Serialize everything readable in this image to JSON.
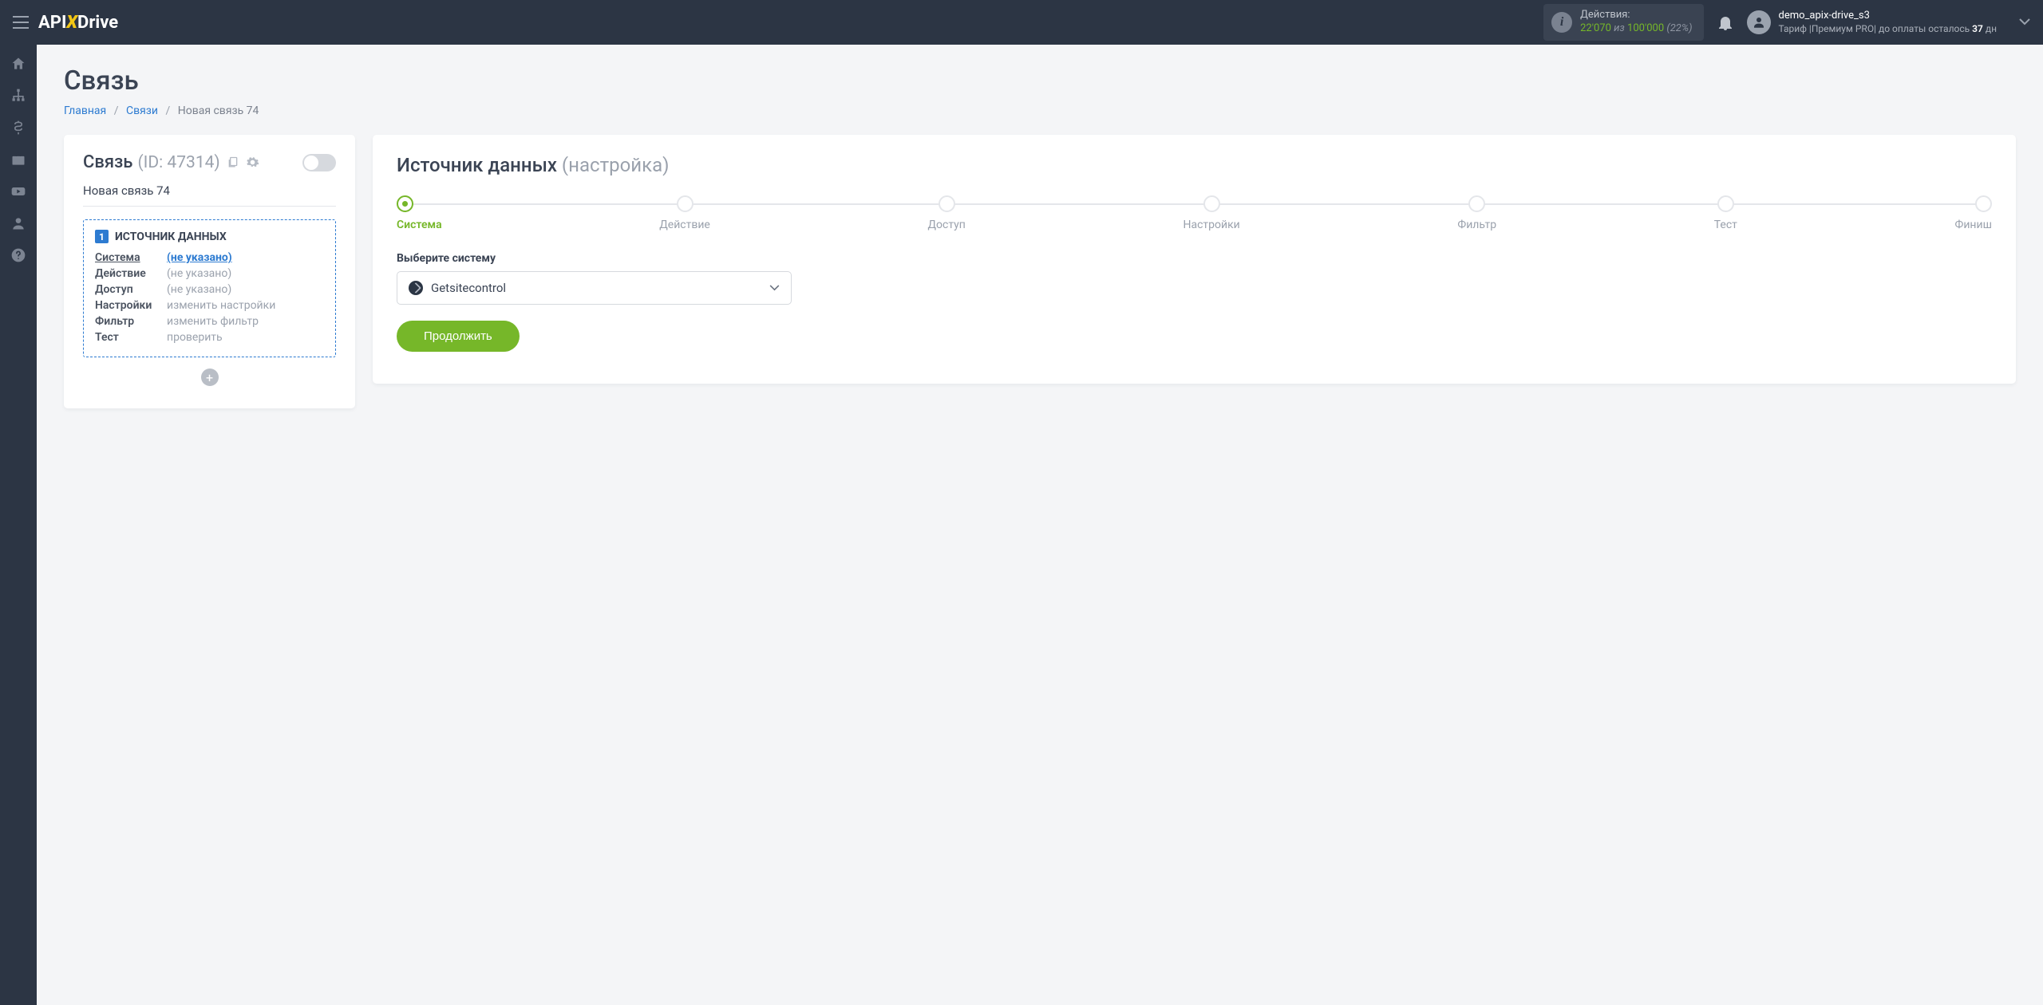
{
  "header": {
    "logo_pre": "API",
    "logo_x": "X",
    "logo_post": "Drive",
    "actions_label": "Действия:",
    "actions_used": "22'070",
    "actions_of": "из",
    "actions_total": "100'000",
    "actions_pct": "(22%)",
    "account_name": "demo_apix-drive_s3",
    "tariff_line_pre": "Тариф |Премиум PRO| до оплаты осталось ",
    "tariff_days": "37",
    "tariff_line_post": " дн"
  },
  "page": {
    "title": "Связь",
    "crumb_home": "Главная",
    "crumb_links": "Связи",
    "crumb_current": "Новая связь 74"
  },
  "left": {
    "title": "Связь",
    "id_label": "(ID: 47314)",
    "name": "Новая связь 74",
    "box_title": "ИСТОЧНИК ДАННЫХ",
    "box_num": "1",
    "rows": {
      "system_lbl": "Система",
      "system_val": "(не указано)",
      "action_lbl": "Действие",
      "action_val": "(не указано)",
      "access_lbl": "Доступ",
      "access_val": "(не указано)",
      "settings_lbl": "Настройки",
      "settings_val": "изменить настройки",
      "filter_lbl": "Фильтр",
      "filter_val": "изменить фильтр",
      "test_lbl": "Тест",
      "test_val": "проверить"
    }
  },
  "right": {
    "title": "Источник данных",
    "subtitle": "(настройка)",
    "steps": [
      "Система",
      "Действие",
      "Доступ",
      "Настройки",
      "Фильтр",
      "Тест",
      "Финиш"
    ],
    "form_label": "Выберите систему",
    "selected_system": "Getsitecontrol",
    "continue": "Продолжить"
  }
}
